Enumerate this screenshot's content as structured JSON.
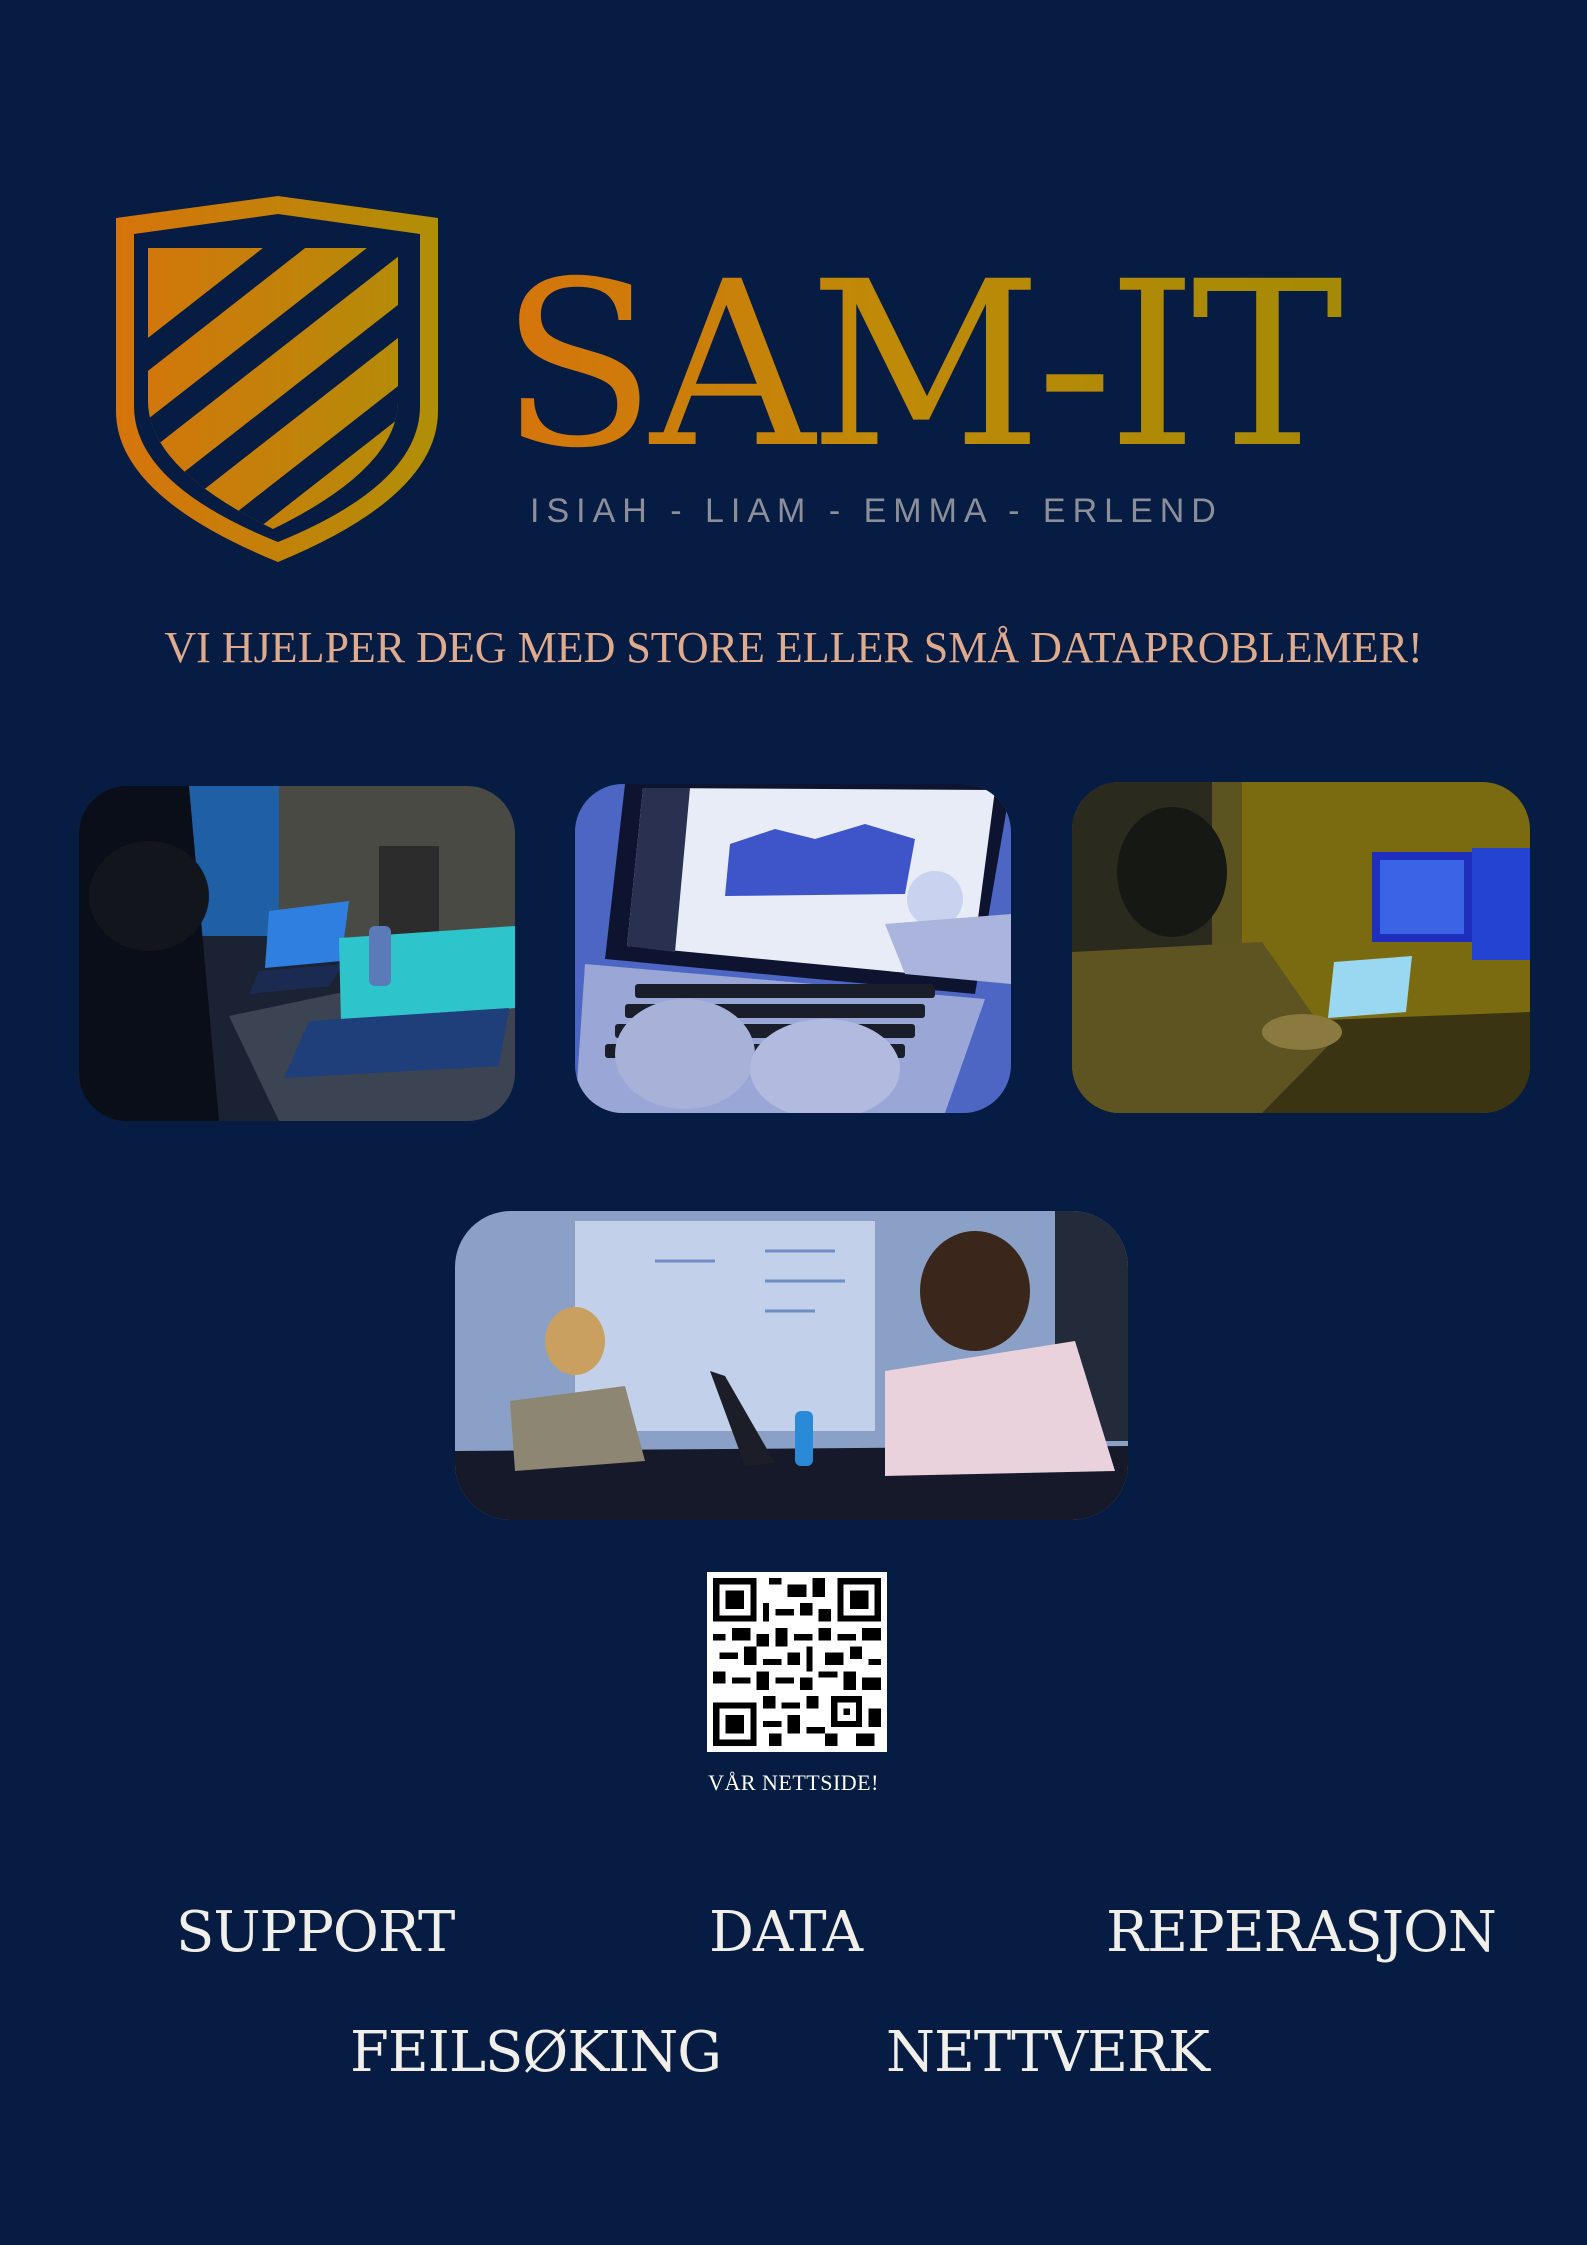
{
  "brand": {
    "name": "SAM-IT",
    "members": "ISIAH  -  LIAM  -  EMMA  -  ERLEND"
  },
  "tagline": "VI HJELPER DEG MED STORE ELLER SMÅ DATAPROBLEMER!",
  "photos": [
    {
      "name": "photo-laptops-dark-room"
    },
    {
      "name": "photo-hands-typing-laptop"
    },
    {
      "name": "photo-person-at-monitors"
    },
    {
      "name": "photo-two-people-at-whiteboard-table"
    }
  ],
  "qr": {
    "caption": "VÅR NETTSIDE!"
  },
  "services": {
    "support": "SUPPORT",
    "data": "DATA",
    "reperasjon": "REPERASJON",
    "feilsoking": "FEILSØKING",
    "nettverk": "NETTVERK"
  },
  "colors": {
    "background": "#061c42",
    "gold": "#c98b0a",
    "orange": "#d6740c",
    "tagline": "#e0aa8d"
  }
}
